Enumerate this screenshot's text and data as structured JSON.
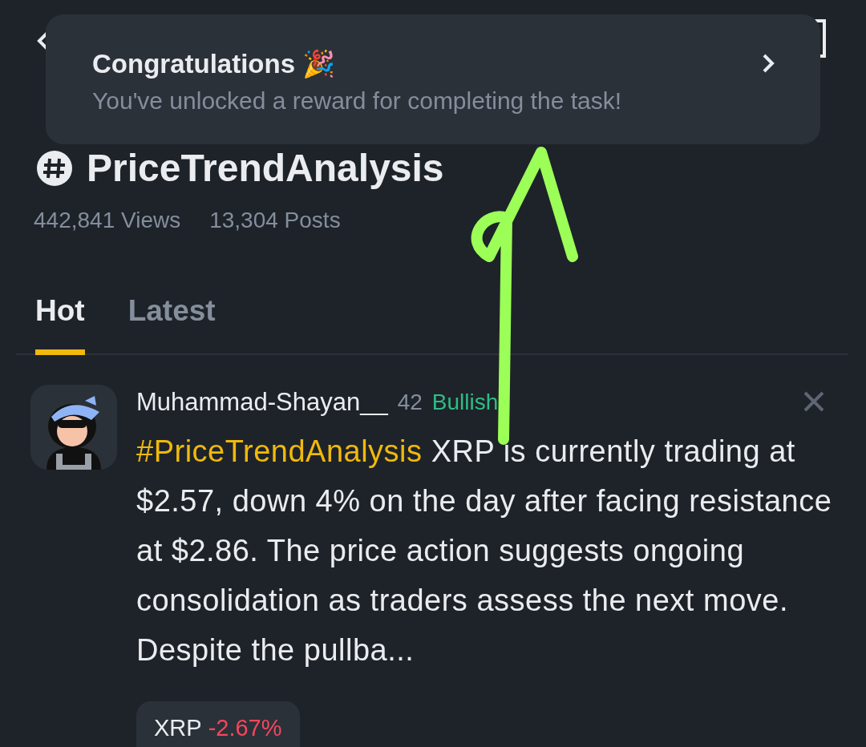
{
  "toast": {
    "title": "Congratulations 🎉",
    "message": "You've unlocked a reward for completing the task!"
  },
  "topic": {
    "title": "PriceTrendAnalysis",
    "views": "442,841",
    "views_label": "Views",
    "posts": "13,304",
    "posts_label": "Posts"
  },
  "tabs": [
    {
      "label": "Hot",
      "selected": true
    },
    {
      "label": "Latest",
      "selected": false
    }
  ],
  "post": {
    "author": "Muhammad-Shayan__",
    "time": "42",
    "sentiment": "Bullish",
    "hashtag": "#PriceTrendAnalysis",
    "text": "XRP is currently trading at $2.57, down 4% on the day after facing resistance at $2.86. The price action suggests ongoing consolidation as traders assess the next move. Despite the pullba...",
    "coin": {
      "symbol": "XRP",
      "change": "-2.67%"
    }
  }
}
